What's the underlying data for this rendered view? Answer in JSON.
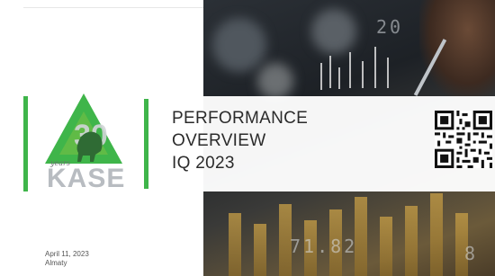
{
  "logo": {
    "text": "KASE",
    "badge": "30",
    "badge_script": "years",
    "icon": "bull-triangle-logo"
  },
  "title": {
    "lines": [
      "PERFORMANCE",
      "OVERVIEW",
      "IQ 2023"
    ]
  },
  "meta": {
    "date": "April 11, 2023",
    "city": "Almaty"
  },
  "photo": {
    "numbers": [
      "20",
      "71.82",
      "8"
    ]
  },
  "qr_icon": "qr-code-icon",
  "colors": {
    "accent_green": "#3fb54a",
    "title_text": "#2b2b2b",
    "logo_gray": "#b8bcc1"
  }
}
